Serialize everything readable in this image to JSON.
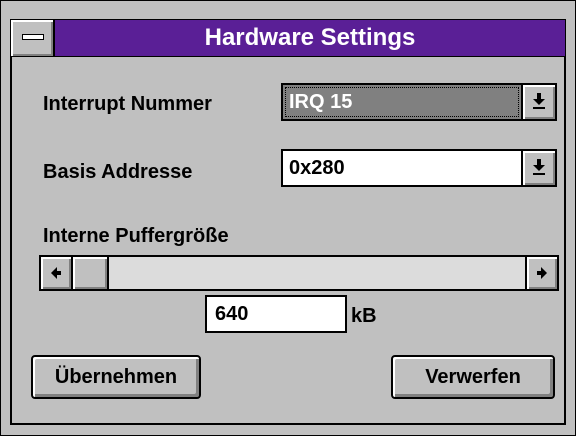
{
  "window": {
    "title": "Hardware Settings"
  },
  "interrupt": {
    "label": "Interrupt Nummer",
    "value": "IRQ 15"
  },
  "base_address": {
    "label": "Basis Addresse",
    "value": "0x280"
  },
  "buffer": {
    "label": "Interne Puffergröße",
    "value": "640",
    "unit": "kB"
  },
  "buttons": {
    "apply": "Übernehmen",
    "discard": "Verwerfen"
  },
  "colors": {
    "titlebar": "#5a1f96",
    "face": "#c0c0c0",
    "selection": "#808080"
  },
  "icons": {
    "system_menu": "system-menu-icon",
    "dropdown": "dropdown-arrow-icon",
    "scroll_left": "arrow-left-icon",
    "scroll_right": "arrow-right-icon"
  }
}
